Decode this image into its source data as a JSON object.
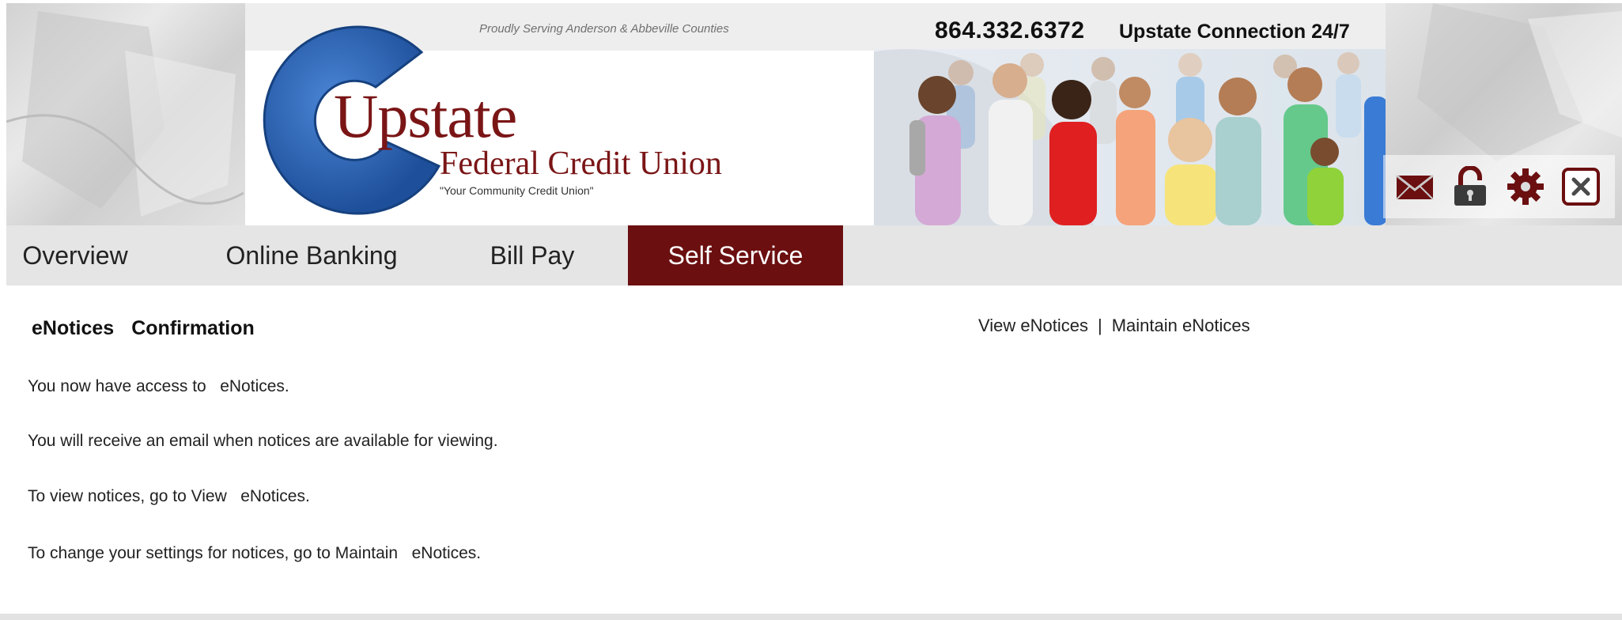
{
  "header": {
    "tagline": "Proudly Serving Anderson & Abbeville Counties",
    "phone": "864.332.6372",
    "connection": "Upstate Connection 24/7",
    "logo": {
      "name": "Upstate",
      "subtitle": "Federal Credit Union",
      "motto": "\"Your Community Credit Union\""
    },
    "icons": [
      "mail-icon",
      "lock-icon",
      "gear-icon",
      "close-icon"
    ]
  },
  "nav": {
    "items": [
      {
        "label": "Overview"
      },
      {
        "label": "Online Banking"
      },
      {
        "label": "Bill Pay"
      },
      {
        "label": "Self Service",
        "active": true
      }
    ]
  },
  "content": {
    "title_part1": "eNotices",
    "title_part2": "Confirmation",
    "links": {
      "view": "View eNotices",
      "separator": "|",
      "maintain": "Maintain eNotices"
    },
    "paragraphs": [
      "You now have access to   eNotices.",
      "You will receive an email when notices are available for viewing.",
      "To view notices, go to View   eNotices.",
      "To change your settings for notices, go to Maintain   eNotices."
    ]
  },
  "colors": {
    "brand_maroon": "#6b0f10",
    "logo_blue": "#2a5ea8",
    "nav_bg": "#e5e5e5"
  }
}
